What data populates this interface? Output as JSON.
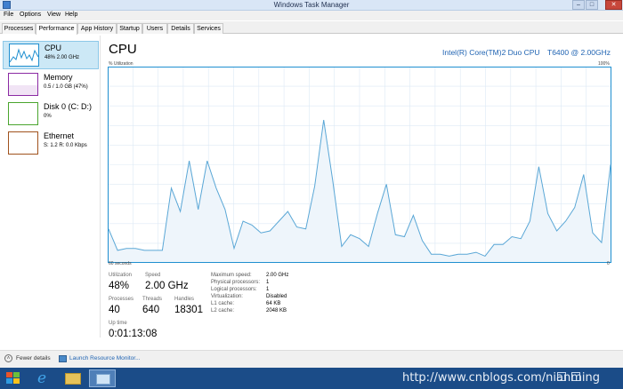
{
  "window": {
    "title": "Windows Task Manager"
  },
  "menu": [
    "File",
    "Options",
    "View",
    "Help"
  ],
  "tabs": [
    "Processes",
    "Performance",
    "App History",
    "Startup",
    "Users",
    "Details",
    "Services"
  ],
  "sidebar": {
    "items": [
      {
        "name": "CPU",
        "value": "48% 2.00 GHz",
        "color": "#1f8fd0"
      },
      {
        "name": "Memory",
        "value": "0.5 / 1.0 GB (47%)",
        "color": "#8b2aa3"
      },
      {
        "name": "Disk 0 (C: D:)",
        "value": "0%",
        "color": "#4aa52e"
      },
      {
        "name": "Ethernet",
        "value": "S: 1.2  R: 0.0 Kbps",
        "color": "#a0521d"
      }
    ]
  },
  "main": {
    "title": "CPU",
    "model": "Intel(R) Core(TM)2 Duo CPU",
    "speed": "T6400  @ 2.00GHz",
    "utilization_label": "% Utilization",
    "max_label": "100%",
    "seconds_label": "60 seconds",
    "zero_label": "0",
    "stats": {
      "utilization": {
        "label": "Utilization",
        "value": "48%"
      },
      "speed": {
        "label": "Speed",
        "value": "2.00 GHz"
      },
      "processes": {
        "label": "Processes",
        "value": "40"
      },
      "threads": {
        "label": "Threads",
        "value": "640"
      },
      "handles": {
        "label": "Handles",
        "value": "18301"
      },
      "uptime": {
        "label": "Up time",
        "value": "0:01:13:08"
      }
    },
    "specs": [
      {
        "label": "Maximum speed:",
        "value": "2.00 GHz"
      },
      {
        "label": "Physical processors:",
        "value": "1"
      },
      {
        "label": "Logical processors:",
        "value": "1"
      },
      {
        "label": "Virtualization:",
        "value": "Disabled"
      },
      {
        "label": "L1 cache:",
        "value": "64 KB"
      },
      {
        "label": "L2 cache:",
        "value": "2048 KB"
      }
    ],
    "series_percent": [
      17,
      6,
      7,
      7,
      6,
      6,
      6,
      38,
      26,
      52,
      27,
      52,
      38,
      27,
      7,
      21,
      19,
      15,
      16,
      21,
      26,
      18,
      17,
      39,
      73,
      42,
      8,
      14,
      12,
      8,
      25,
      40,
      14,
      13,
      24,
      11,
      4,
      4,
      3,
      4,
      4,
      5,
      3,
      9,
      9,
      13,
      12,
      21,
      49,
      25,
      16,
      21,
      28,
      45,
      15,
      10,
      50
    ]
  },
  "footer": {
    "fewer_details": "Fewer details",
    "launch": "Launch Resource Monitor..."
  },
  "taskbar": {
    "watermark": "http://www.cnblogs.com/nianming"
  },
  "colors": {
    "graph_line": "#5aa7d6",
    "graph_fill": "#eef5fb",
    "grid": "#dde9f5"
  }
}
